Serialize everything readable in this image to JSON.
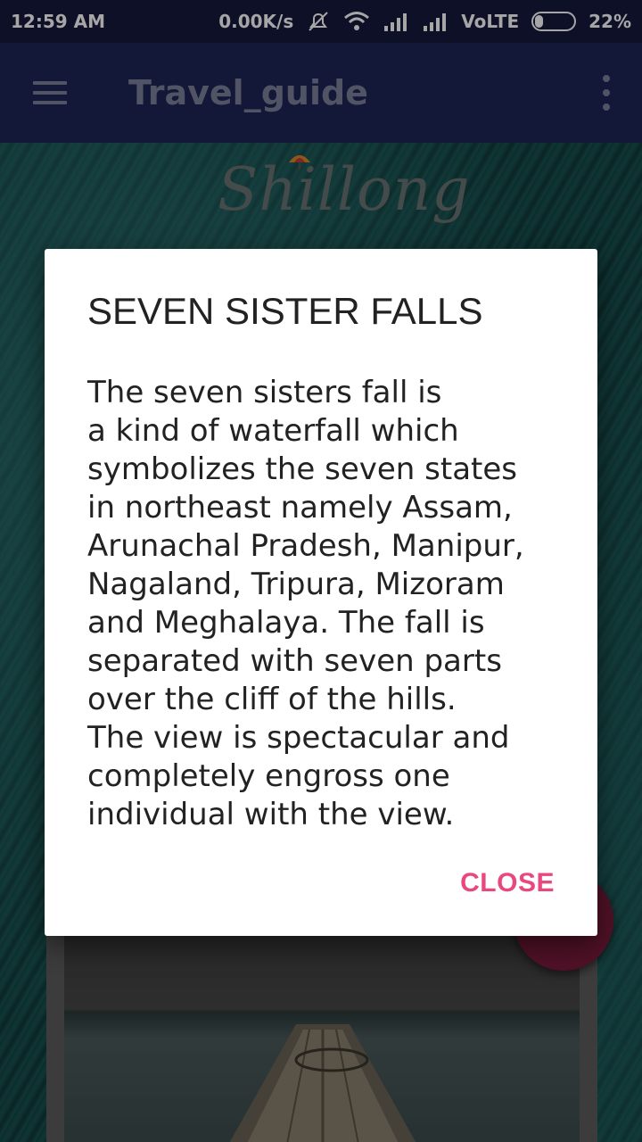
{
  "status_bar": {
    "time": "12:59 AM",
    "net_speed": "0.00K/s",
    "network_type": "VoLTE",
    "battery_text": "22%",
    "battery_level": 0.22
  },
  "toolbar": {
    "title": "Travel_guide"
  },
  "background": {
    "logo_text": "Shillong"
  },
  "dialog": {
    "title": "SEVEN SISTER FALLS",
    "body": "The seven sisters fall is\na kind of waterfall which\nsymbolizes the seven states\nin northeast namely Assam,\nArunachal Pradesh, Manipur,\nNagaland, Tripura, Mizoram\nand Meghalaya. The fall is\nseparated with seven parts\nover the cliff of the hills.\nThe view is spectacular and\ncompletely engross one\nindividual with the view.",
    "close_label": "CLOSE"
  },
  "colors": {
    "toolbar": "#1f2557",
    "status_bar": "#151a3c",
    "accent": "#e8487f",
    "fab": "#7b1b3d"
  },
  "icons": [
    "menu-icon",
    "overflow-menu-icon",
    "mail-icon",
    "wifi-icon",
    "signal-icon",
    "mute-icon",
    "battery-icon"
  ]
}
